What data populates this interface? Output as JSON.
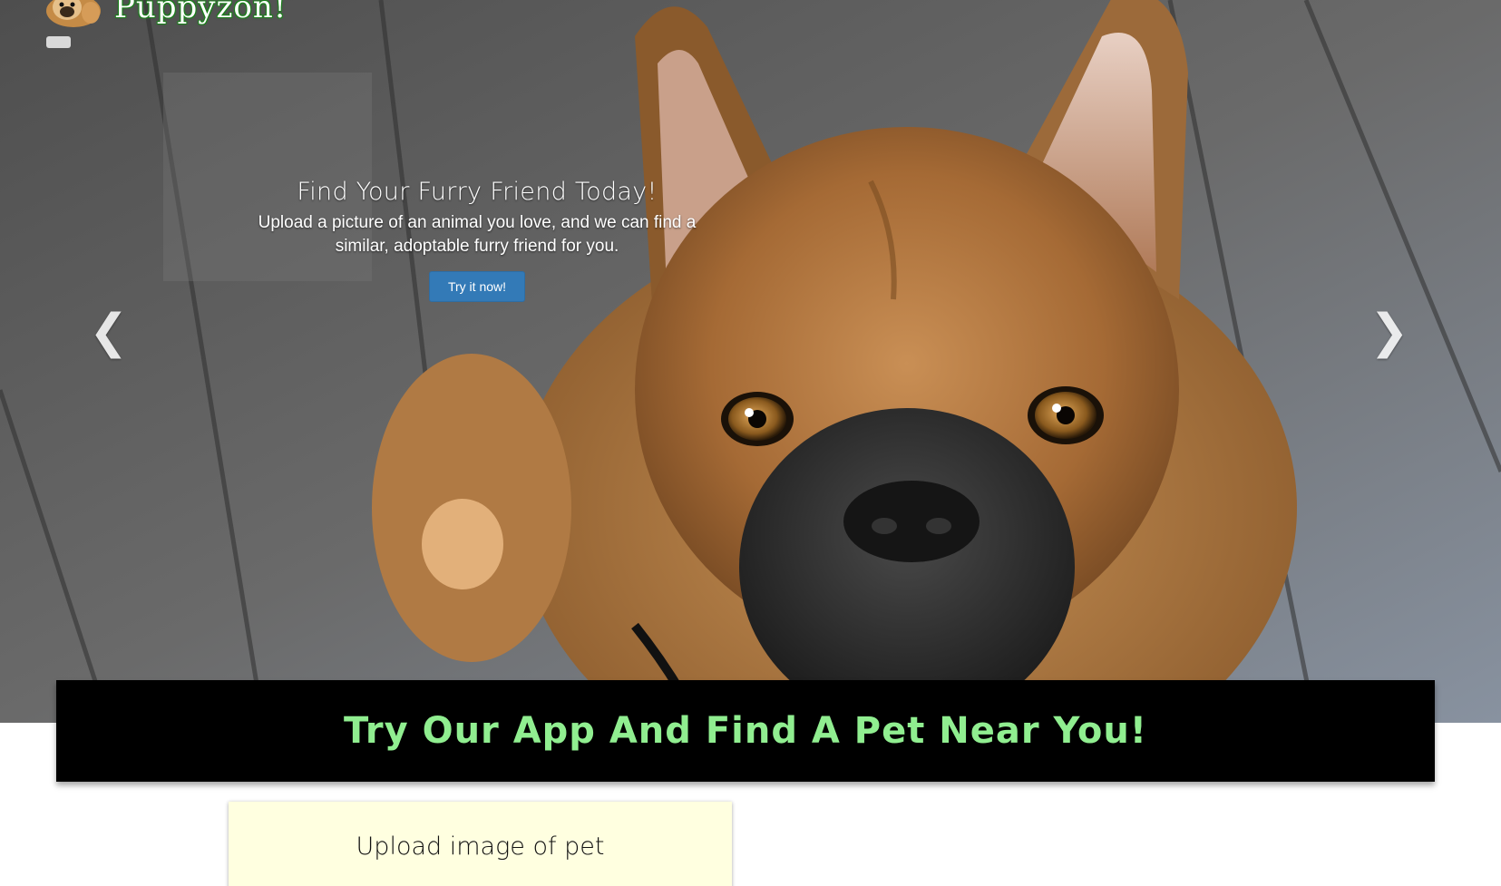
{
  "brand": {
    "name": "Puppyzon!",
    "logo_icon": "pug-icon",
    "logo_color": "#1b7f1b"
  },
  "nav": {
    "toggle_icon": "menu-toggle-icon"
  },
  "hero": {
    "title": "Find Your Furry Friend Today!",
    "text": "Upload a picture of an animal you love, and we can find a similar, adoptable furry friend for you.",
    "button_label": "Try it now!",
    "button_color": "#337ab7",
    "prev_arrow": "❮",
    "next_arrow": "❯"
  },
  "banner": {
    "text": "Try Our App And Find A Pet Near You!",
    "text_color": "#90ee90",
    "background": "#000000"
  },
  "upload": {
    "title": "Upload image of pet",
    "background": "#ffffe0"
  }
}
